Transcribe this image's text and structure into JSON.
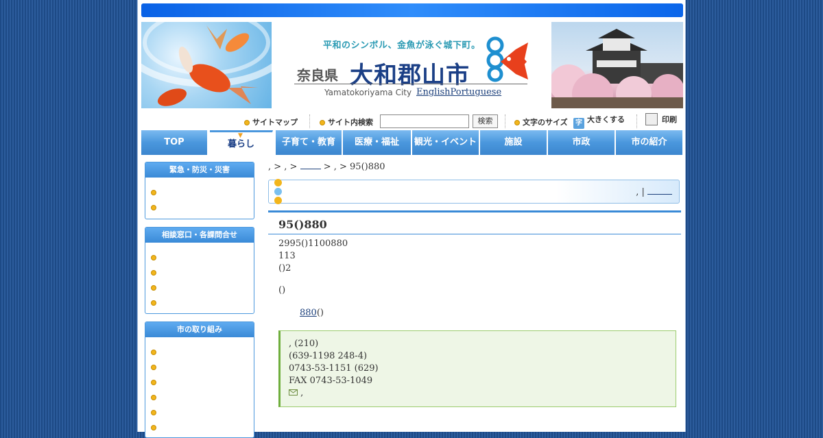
{
  "header": {
    "catchphrase": "平和のシンボル、金魚が泳ぐ城下町。",
    "prefecture": "奈良県",
    "city_name": "大和郡山市",
    "romaji": "Yamatokoriyama City",
    "lang_english": "English",
    "lang_portuguese": "Portuguese"
  },
  "utility": {
    "sitemap": "サイトマップ",
    "site_search": "サイト内検索",
    "search_placeholder": "",
    "search_button": "検索",
    "font_size": "文字のサイズ",
    "enlarge": "大きくする",
    "print": "印刷"
  },
  "nav": {
    "tabs": [
      "TOP",
      "暮らし",
      "子育て・教育",
      "医療・福祉",
      "観光・イベント",
      "施設",
      "市政",
      "市の紹介"
    ]
  },
  "sidebar": {
    "box1_title": "緊急・防災・災害",
    "box2_title": "相談窓口・各課問合せ",
    "box3_title": "市の取り組み"
  },
  "breadcrumb": {
    "part1": ", > , > ",
    "part2": " > , > 95()880"
  },
  "section_bar": {
    "right_text": ", | "
  },
  "content": {
    "title": "95()880",
    "line1": "2995()1100880",
    "line2": "113",
    "line3": "()2",
    "paren_line": "()",
    "link_text": "880",
    "link_suffix": "()"
  },
  "contact": {
    "line1": ", (210)",
    "line2": " (639-1198  248-4)",
    "line3": " 0743-53-1151 (629)",
    "line4": "FAX 0743-53-1049",
    "line5": " ,"
  },
  "colors": {
    "nav_blue": "#4a97dd",
    "title_navy": "#1b3f86",
    "contact_green": "#9ccc6e"
  }
}
